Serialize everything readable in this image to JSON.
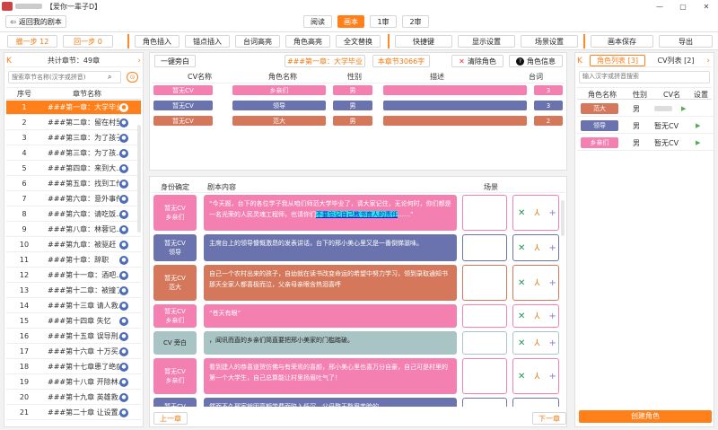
{
  "window": {
    "title": "【爱你一辈子D】",
    "min": "—",
    "max": "▢",
    "close": "✕"
  },
  "top": {
    "back": "返回我的剧本",
    "tabs": [
      "阅读",
      "画本",
      "1审",
      "2审"
    ],
    "active_tab": 1
  },
  "toolbar": {
    "undo": "撤一步 12",
    "redo": "回一步 0",
    "items": [
      "角色插入",
      "锚点插入",
      "台词高亮",
      "角色高亮",
      "全文替换",
      "快捷键",
      "显示设置",
      "场景设置",
      "画本保存",
      "导出"
    ]
  },
  "left": {
    "nav_prev": "K",
    "total": "共计章节：49章",
    "nav_next": "›",
    "search_placeholder": "搜索章节名称(汉字或拼音)",
    "col_idx": "序号",
    "col_name": "章节名称",
    "chapters": [
      {
        "idx": "1",
        "name": "###第一章：大学毕业"
      },
      {
        "idx": "2",
        "name": "###第二章：留在村里"
      },
      {
        "idx": "3",
        "name": "###第三章：为了孩子们..."
      },
      {
        "idx": "4",
        "name": "###第三章：为了孩..."
      },
      {
        "idx": "5",
        "name": "###第四章：来到大..."
      },
      {
        "idx": "6",
        "name": "###第五章：找到工作"
      },
      {
        "idx": "7",
        "name": "###第六章：意外事件"
      },
      {
        "idx": "8",
        "name": "###第六章：请吃饭..."
      },
      {
        "idx": "9",
        "name": "###第八章：林蓉记..."
      },
      {
        "idx": "10",
        "name": "###第九章：被驱赶"
      },
      {
        "idx": "11",
        "name": "###第十章：辞职"
      },
      {
        "idx": "12",
        "name": "###第十一章：酒吧..."
      },
      {
        "idx": "13",
        "name": "###第十二章：被撞了"
      },
      {
        "idx": "14",
        "name": "###第十三章 请人救..."
      },
      {
        "idx": "15",
        "name": "###第十四章 失忆"
      },
      {
        "idx": "16",
        "name": "###第十五章 误导刑..."
      },
      {
        "idx": "17",
        "name": "###第十六章 十万买..."
      },
      {
        "idx": "18",
        "name": "###第十七章患了绝症"
      },
      {
        "idx": "19",
        "name": "###第十八章 开除林..."
      },
      {
        "idx": "20",
        "name": "###第十九章 英雄救..."
      },
      {
        "idx": "21",
        "name": "###第二十章 让设置..."
      }
    ]
  },
  "mid": {
    "narrator_btn": "一键旁白",
    "chapter_title": "###第一章：大学毕业",
    "chapter_words": "本章节3066字",
    "clear_role": "清除角色",
    "role_info": "角色信息",
    "role_cols": [
      "CV名称",
      "角色名称",
      "性别",
      "描述",
      "台词"
    ],
    "roles": [
      {
        "cv": "暂无CV",
        "name": "乡亲们",
        "sex": "男",
        "desc": "",
        "lines": "3",
        "color": "pink"
      },
      {
        "cv": "暂无CV",
        "name": "领导",
        "sex": "男",
        "desc": "",
        "lines": "3",
        "color": "purple"
      },
      {
        "cv": "暂无CV",
        "name": "范大",
        "sex": "男",
        "desc": "",
        "lines": "2",
        "color": "salmon"
      }
    ],
    "script_cols": [
      "身份确定",
      "剧本内容",
      "场景"
    ],
    "lines": [
      {
        "id": "暂无CV\n乡亲们",
        "text": "“今天题，台下的各位学子我从咱们师范大学毕业了，请大家记住，无论何时，你们都是一名光荣的人民灵魂工程师，也请你们",
        "hl": "不要忘记自己教书育人的责任",
        "tail": "……”",
        "color": "pink"
      },
      {
        "id": "暂无CV\n领导",
        "text": "主席台上的领导慷慨激昂的发表讲话，台下的邢小美心里又是一番倒悌滋味。",
        "color": "purple"
      },
      {
        "id": "暂无CV\n范大",
        "text": "自己一个农村出来的孩子，自幼就在读书改变命运的希望中努力学习，领到录取通知书那天全家人都喜极而泣，父亲母亲眼含热泪喜呼",
        "color": "salmon"
      },
      {
        "id": "暂无CV\n乡亲们",
        "text": "“苍天有眼”",
        "color": "pink"
      },
      {
        "id": "CV  旁白",
        "text": "，闻讯而直的乡亲们简直要把邢小美家的门槛踏破。",
        "color": "grey"
      },
      {
        "id": "暂无CV\n乡亲们",
        "text": "看到建人的恭喜道贺仿佛与有荣焉的喜颜，邢小美心里也喜万分自豪，自己可是村里的第一个大学生，自己总算能让村里扬眉吐气了！",
        "color": "pink"
      },
      {
        "id": "暂无CV\n领导",
        "text": "然而不久邢家就因高额学费而陷入低沉，父母整天愁眉苦脸的。",
        "color": "purple"
      }
    ],
    "icons": [
      "✕",
      "⅄",
      "+"
    ],
    "prev": "上一章",
    "next": "下一章"
  },
  "right": {
    "nav_prev": "K",
    "tab_roles": "角色列表 [3]",
    "tab_cv": "CV列表 [2]",
    "nav_next": "›",
    "search_placeholder": "输入汉字或拼音搜索",
    "cols": [
      "角色名称",
      "性别",
      "CV名",
      "设置"
    ],
    "roles": [
      {
        "name": "范大",
        "sex": "男",
        "cv": "",
        "color": "salmon"
      },
      {
        "name": "领导",
        "sex": "男",
        "cv": "暂无CV",
        "color": "purple"
      },
      {
        "name": "乡亲们",
        "sex": "男",
        "cv": "暂无CV",
        "color": "pink"
      }
    ],
    "play": "▶",
    "create": "创建角色"
  },
  "colors": {
    "accent": "#ff7f1a",
    "pink": "#f47fb1",
    "purple": "#6a73ad",
    "salmon": "#d4775a",
    "grey": "#a9c4c4"
  }
}
